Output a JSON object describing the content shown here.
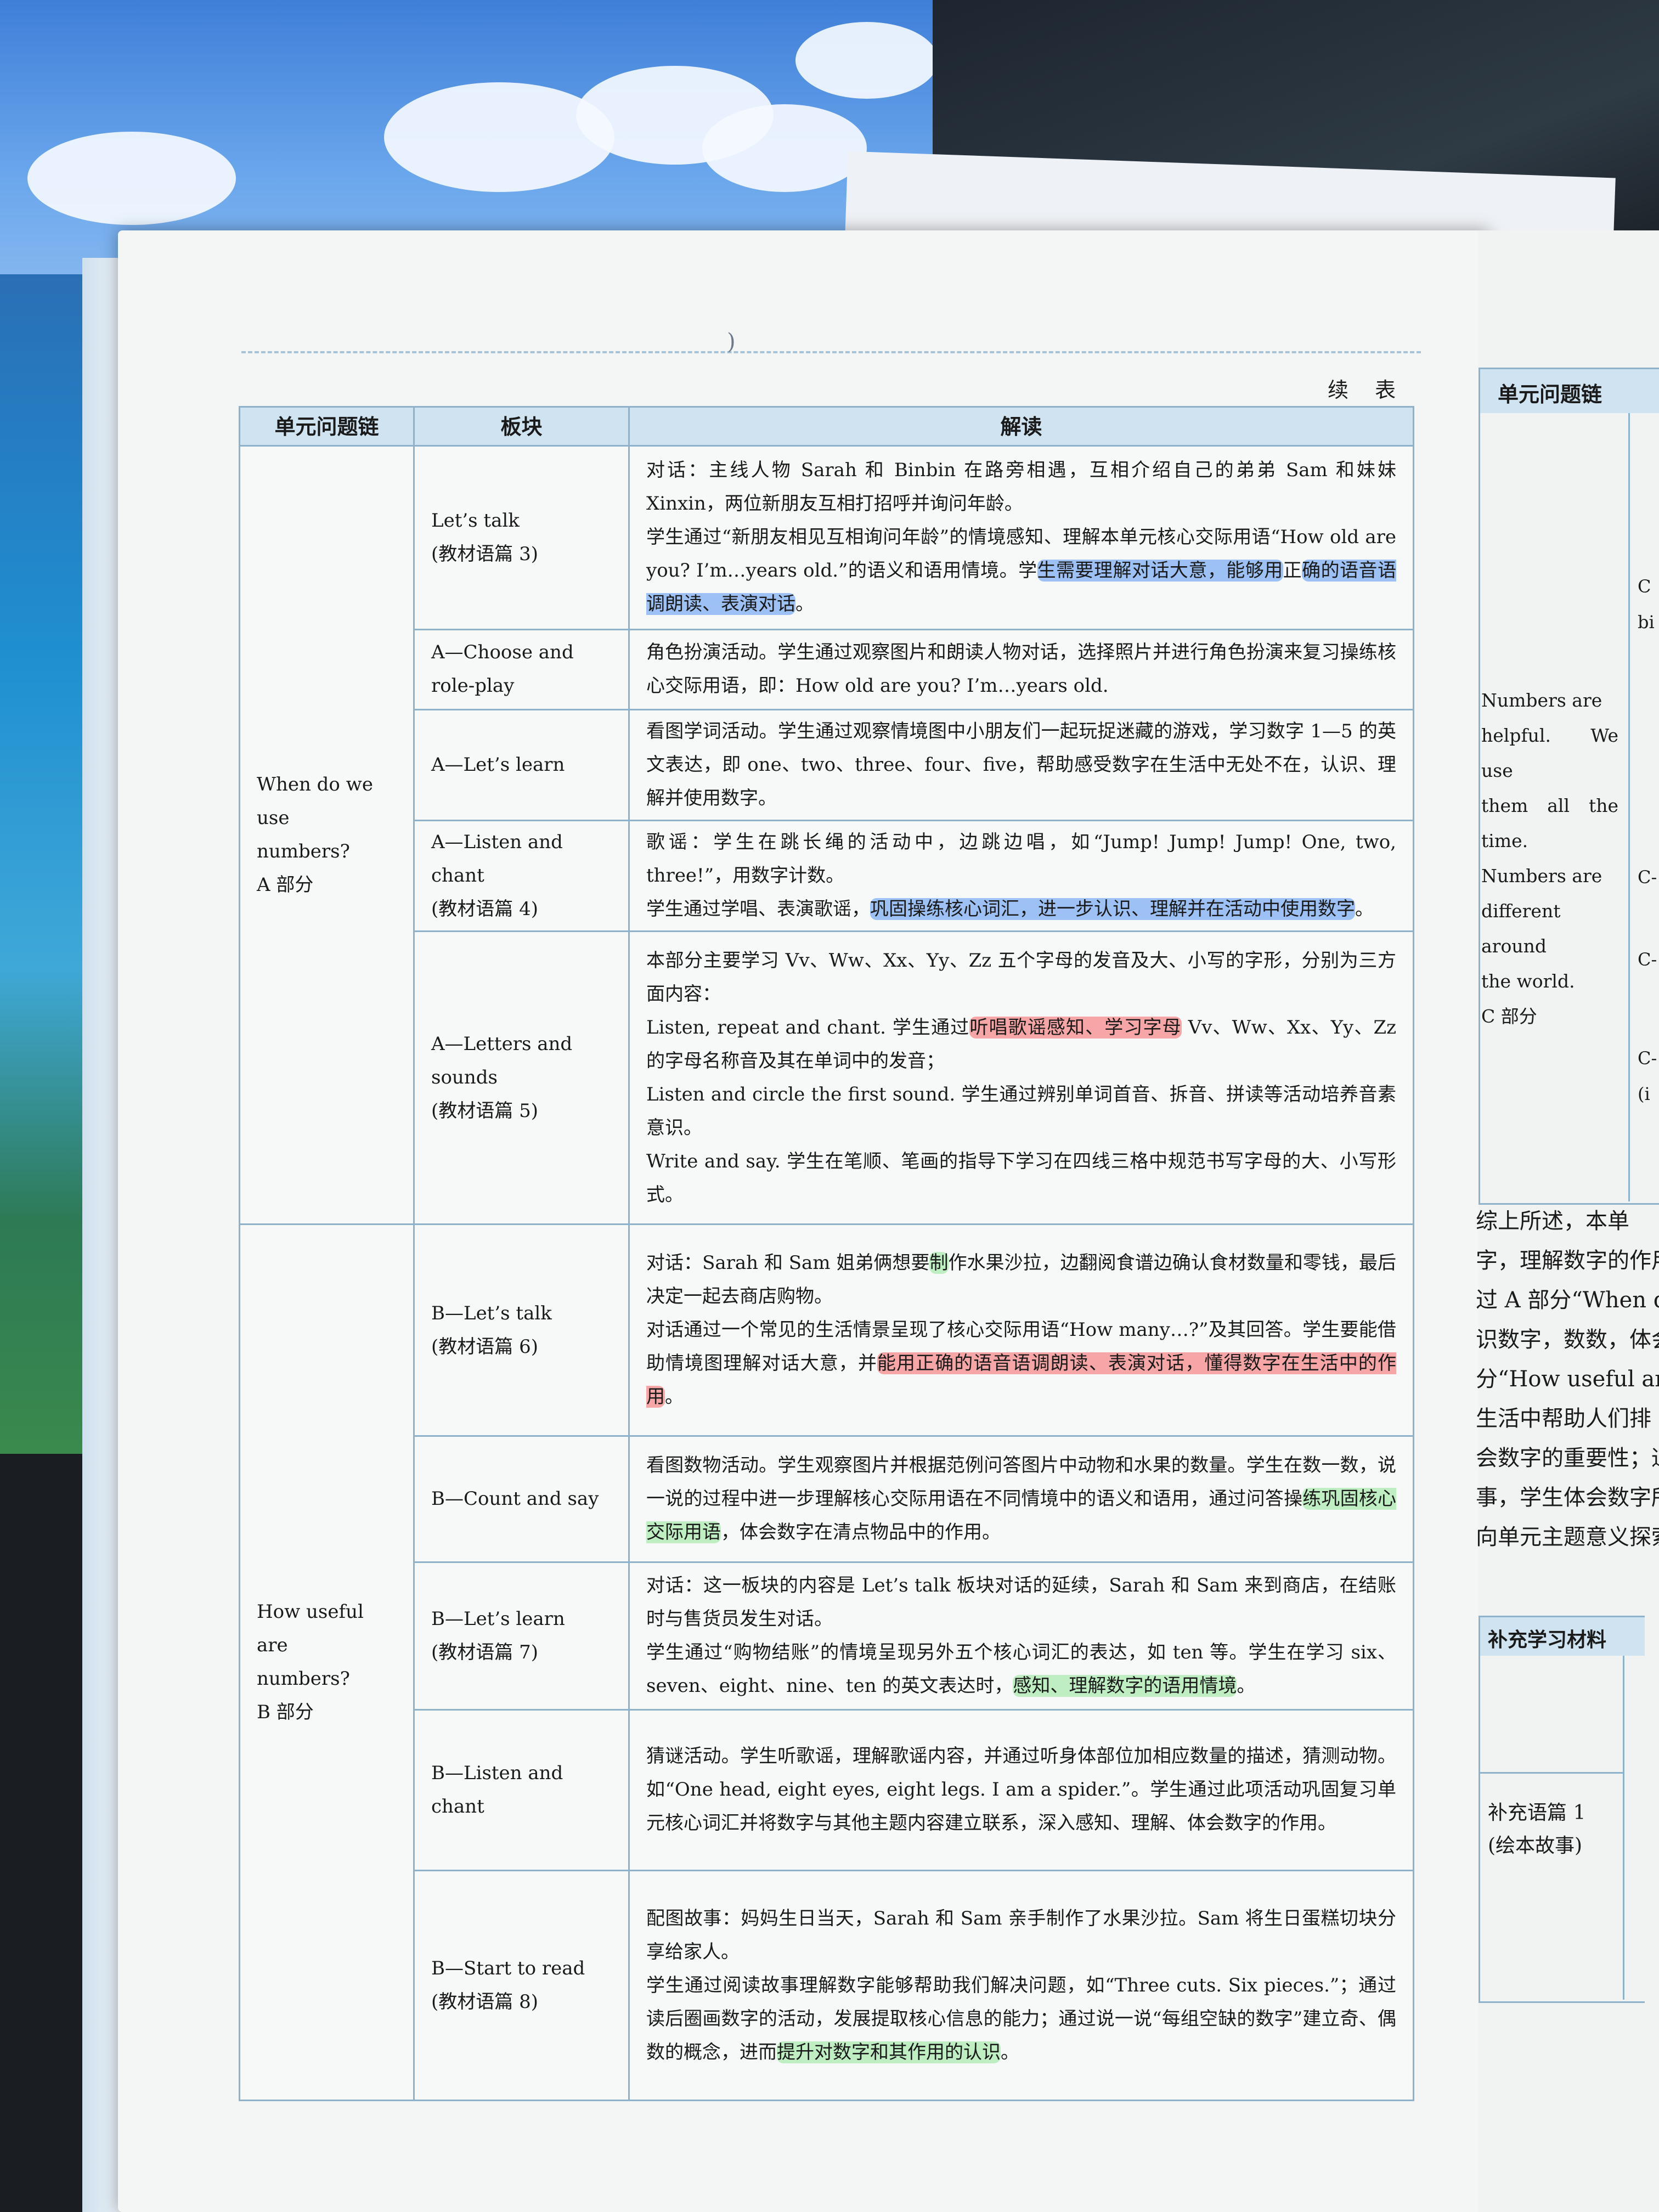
{
  "header": {
    "continued_label": "续 表"
  },
  "table": {
    "headers": [
      "单元问题链",
      "板块",
      "解读"
    ],
    "sections": [
      {
        "lines": [
          "When do we use",
          "numbers?",
          "A 部分"
        ]
      },
      {
        "lines": [
          "How useful are",
          "numbers?",
          "B 部分"
        ]
      }
    ],
    "rows": [
      {
        "block": [
          "Let’s talk",
          "(教材语篇 3)"
        ],
        "paras": [
          [
            {
              "t": "对话：主线人物 Sarah 和 Binbin 在路旁相遇，互相介绍自己的弟弟 Sam 和妹妹 Xinxin，两位新朋友互相打招呼并询问年龄。"
            }
          ],
          [
            {
              "t": "学生通过“新朋友相见互相询问年龄”的情境感知、理解本单元核心交际用语“How old are you? I’m…years old.”的语义和语用情境。学"
            },
            {
              "t": "生需要理解对话大意，能够用",
              "hl": "blue"
            },
            {
              "t": "正"
            },
            {
              "t": "确的语音语调朗读、表演对话",
              "hl": "blue"
            },
            {
              "t": "。"
            }
          ]
        ]
      },
      {
        "block": [
          "A—Choose and",
          "role-play"
        ],
        "paras": [
          [
            {
              "t": "角色扮演活动。学生通过观察图片和朗读人物对话，选择照片并进行角色扮演来复习操练核心交际用语，即：How old are you? I’m…years old."
            }
          ]
        ]
      },
      {
        "block": [
          "A—Let’s learn"
        ],
        "paras": [
          [
            {
              "t": "看图学词活动。学生通过观察情境图中小朋友们一起玩捉迷藏的游戏，学习数字 1—5 的英文表达，即 one、two、three、four、five，帮助感受数字在生活中无处不在，认识、理解并使用数字。"
            }
          ]
        ]
      },
      {
        "block": [
          "A—Listen and chant",
          "(教材语篇 4)"
        ],
        "paras": [
          [
            {
              "t": "歌谣：学生在跳长绳的活动中，边跳边唱，如“Jump! Jump! Jump! One, two, three!”，用数字计数。"
            }
          ],
          [
            {
              "t": "学生通过学唱、表演歌谣，"
            },
            {
              "t": "巩固操练核心词汇，进一步认识、理解并在活动中使用数字",
              "hl": "blue"
            },
            {
              "t": "。"
            }
          ]
        ]
      },
      {
        "block": [
          "A—Letters and sounds",
          "(教材语篇 5)"
        ],
        "paras": [
          [
            {
              "t": "本部分主要学习 Vv、Ww、Xx、Yy、Zz 五个字母的发音及大、小写的字形，分别为三方面内容："
            }
          ],
          [
            {
              "t": "Listen, repeat and chant. 学生通过"
            },
            {
              "t": "听唱歌谣感知、学习字母",
              "hl": "red"
            },
            {
              "t": " Vv、Ww、Xx、Yy、Zz 的字母名称音及其在单词中的发音；"
            }
          ],
          [
            {
              "t": "Listen and circle the first sound. 学生通过辨别单词首音、拆音、拼读等活动培养音素意识。"
            }
          ],
          [
            {
              "t": "Write and say. 学生在笔顺、笔画的指导下学习在四线三格中规范书写字母的大、小写形式。"
            }
          ]
        ]
      },
      {
        "block": [
          "B—Let’s talk",
          "(教材语篇 6)"
        ],
        "paras": [
          [
            {
              "t": "对话：Sarah 和 Sam 姐弟俩想要"
            },
            {
              "t": "制",
              "hl": "green"
            },
            {
              "t": "作水果沙拉，边翻阅食谱边确认食材数量和零钱，最后决定一起去商店购物。"
            }
          ],
          [
            {
              "t": "对话通过一个常见的生活情景呈现了核心交际用语“How many…?”及其回答。学生要能借助情境图理解对话大意，并"
            },
            {
              "t": "能用正确的语音语调朗读、表演对话，懂得数字在生活中的作用",
              "hl": "red"
            },
            {
              "t": "。"
            }
          ]
        ]
      },
      {
        "block": [
          "B—Count and say"
        ],
        "paras": [
          [
            {
              "t": "看图数物活动。学生观察图片并根据范例问答图片中动物和水果的数量。学生在数一数，说一说的过程中进一步理解核心交际用语在不同情境中的语义和语用，通过问答操"
            },
            {
              "t": "练巩固核心交际用语",
              "hl": "green"
            },
            {
              "t": "，体会数字在清点物品中的作用。"
            }
          ]
        ]
      },
      {
        "block": [
          "B—Let’s learn",
          "(教材语篇 7)"
        ],
        "paras": [
          [
            {
              "t": "对话：这一板块的内容是 Let’s talk 板块对话的延续，Sarah 和 Sam 来到商店，在结账时与售货员发生对话。"
            }
          ],
          [
            {
              "t": "学生通过“购物结账”的情境呈现另外五个核心词汇的表达，如 ten 等。学生在学习 six、seven、eight、nine、ten 的英文表达时，"
            },
            {
              "t": "感知、理解数字的语用情境",
              "hl": "green"
            },
            {
              "t": "。"
            }
          ]
        ]
      },
      {
        "block": [
          "B—Listen and chant"
        ],
        "paras": [
          [
            {
              "t": "猜谜活动。学生听歌谣，理解歌谣内容，并通过听身体部位加相应数量的描述，猜测动物。如“One head, eight eyes, eight legs. I am a spider.”。学生通过此项活动巩固复习单元核心词汇并将数字与其他主题内容建立联系，深入感知、理解、体会数字的作用。"
            }
          ]
        ]
      },
      {
        "block": [
          "B—Start to read",
          "(教材语篇 8)"
        ],
        "paras": [
          [
            {
              "t": "配图故事：妈妈生日当天，Sarah 和 Sam 亲手制作了水果沙拉。Sam 将生日蛋糕切块分享给家人。"
            }
          ],
          [
            {
              "t": "学生通过阅读故事理解数字能够帮助我们解决问题，如“Three cuts. Six pieces.”；通过读后圈画数字的活动，发展提取核心信息的能力；通过说一说“每组空缺的数字”建立奇、偶数的概念，进而"
            },
            {
              "t": "提升对数字和其作用的认识",
              "hl": "green"
            },
            {
              "t": "。"
            }
          ]
        ]
      }
    ]
  },
  "right_page": {
    "table_header": "单元问题链",
    "snippet_lines": [
      "Numbers are",
      "helpful. We use",
      "them all the time.",
      "Numbers are",
      "different around",
      "the world.",
      "C 部分"
    ],
    "column_marks": [
      "C",
      "bi",
      "C-",
      "C-",
      "C-",
      "(i"
    ],
    "paragraph_lines": [
      "   综上所述，本单",
      "字，理解数字的作用",
      "过 A 部分“When do",
      "识数字，数数，体会数",
      "分“How useful are n",
      "生活中帮助人们排",
      "会数字的重要性；通",
      "事，学生体会数字所",
      "向单元主题意义探索"
    ],
    "supplement_title": "补充学习材料",
    "supplement_item": [
      "补充语篇 1",
      "(绘本故事)"
    ]
  }
}
